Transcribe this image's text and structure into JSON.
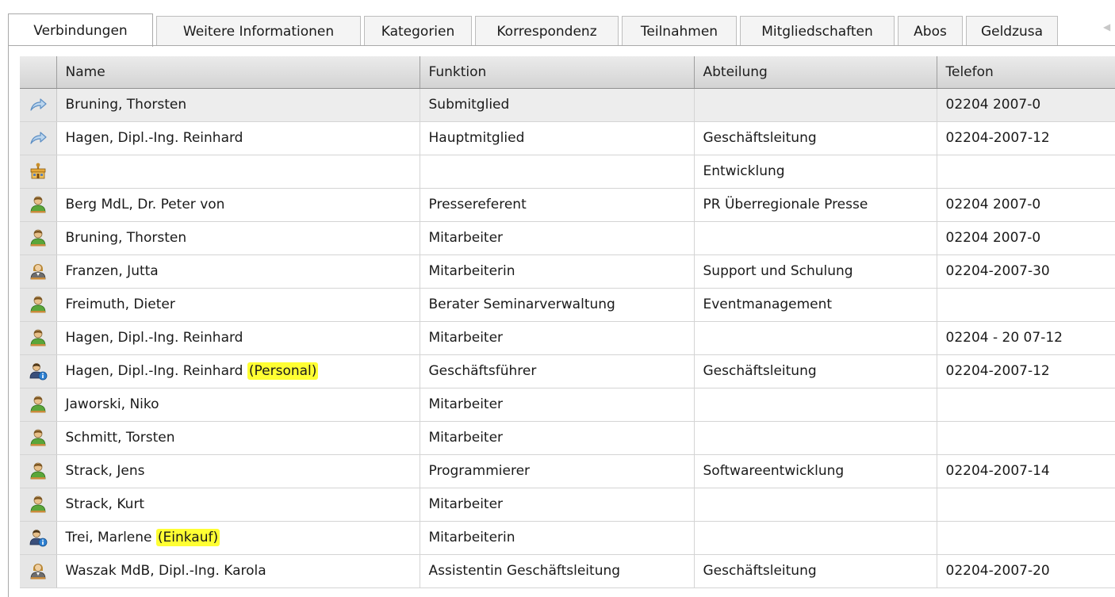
{
  "tabs": [
    {
      "label": "Verbindungen",
      "active": true,
      "width": 183
    },
    {
      "label": "Weitere Informationen",
      "active": false,
      "width": 258
    },
    {
      "label": "Kategorien",
      "active": false,
      "width": 136
    },
    {
      "label": "Korrespondenz",
      "active": false,
      "width": 181
    },
    {
      "label": "Teilnahmen",
      "active": false,
      "width": 145
    },
    {
      "label": "Mitgliedschaften",
      "active": false,
      "width": 195
    },
    {
      "label": "Abos",
      "active": false,
      "width": 82
    },
    {
      "label": "Geldzusa",
      "active": false,
      "width": 116
    }
  ],
  "columns": {
    "name": "Name",
    "funktion": "Funktion",
    "abteilung": "Abteilung",
    "telefon": "Telefon"
  },
  "rows": [
    {
      "icon": "link-arrow-icon",
      "name": "Bruning, Thorsten",
      "highlight": "",
      "funktion": "Submitglied",
      "abteilung": "",
      "telefon": "02204 2007-0"
    },
    {
      "icon": "link-arrow-icon",
      "name": "Hagen, Dipl.-Ing. Reinhard",
      "highlight": "",
      "funktion": "Hauptmitglied",
      "abteilung": "Geschäftsleitung",
      "telefon": "02204-2007-12"
    },
    {
      "icon": "department-icon",
      "name": "",
      "highlight": "",
      "funktion": "",
      "abteilung": "Entwicklung",
      "telefon": ""
    },
    {
      "icon": "person-male-icon",
      "name": "Berg MdL, Dr. Peter von",
      "highlight": "",
      "funktion": "Pressereferent",
      "abteilung": "PR Überregionale Presse",
      "telefon": "02204 2007-0"
    },
    {
      "icon": "person-male-icon",
      "name": "Bruning, Thorsten",
      "highlight": "",
      "funktion": "Mitarbeiter",
      "abteilung": "",
      "telefon": "02204 2007-0"
    },
    {
      "icon": "person-female-icon",
      "name": "Franzen, Jutta",
      "highlight": "",
      "funktion": "Mitarbeiterin",
      "abteilung": "Support und Schulung",
      "telefon": "02204-2007-30"
    },
    {
      "icon": "person-male-icon",
      "name": "Freimuth, Dieter",
      "highlight": "",
      "funktion": "Berater Seminarverwaltung",
      "abteilung": "Eventmanagement",
      "telefon": ""
    },
    {
      "icon": "person-male-icon",
      "name": "Hagen, Dipl.-Ing. Reinhard",
      "highlight": "",
      "funktion": "Mitarbeiter",
      "abteilung": "",
      "telefon": "02204 - 20 07-12"
    },
    {
      "icon": "person-info-icon",
      "name": "Hagen, Dipl.-Ing. Reinhard ",
      "highlight": "(Personal)",
      "funktion": "Geschäftsführer",
      "abteilung": "Geschäftsleitung",
      "telefon": "02204-2007-12"
    },
    {
      "icon": "person-male-icon",
      "name": "Jaworski, Niko",
      "highlight": "",
      "funktion": "Mitarbeiter",
      "abteilung": "",
      "telefon": ""
    },
    {
      "icon": "person-male-icon",
      "name": "Schmitt, Torsten",
      "highlight": "",
      "funktion": "Mitarbeiter",
      "abteilung": "",
      "telefon": ""
    },
    {
      "icon": "person-male-icon",
      "name": "Strack, Jens",
      "highlight": "",
      "funktion": "Programmierer",
      "abteilung": "Softwareentwicklung",
      "telefon": "02204-2007-14"
    },
    {
      "icon": "person-male-icon",
      "name": "Strack, Kurt",
      "highlight": "",
      "funktion": "Mitarbeiter",
      "abteilung": "",
      "telefon": ""
    },
    {
      "icon": "person-info-icon",
      "name": "Trei, Marlene ",
      "highlight": "(Einkauf)",
      "funktion": "Mitarbeiterin",
      "abteilung": "",
      "telefon": ""
    },
    {
      "icon": "person-female-icon",
      "name": "Waszak MdB, Dipl.-Ing. Karola",
      "highlight": "",
      "funktion": "Assistentin Geschäftsleitung",
      "abteilung": "Geschäftsleitung",
      "telefon": "02204-2007-20"
    }
  ],
  "colors": {
    "highlight": "#ffff33",
    "header_top": "#ebebeb",
    "header_bottom": "#d3d3d3",
    "icon_column": "#e6e6e6"
  }
}
